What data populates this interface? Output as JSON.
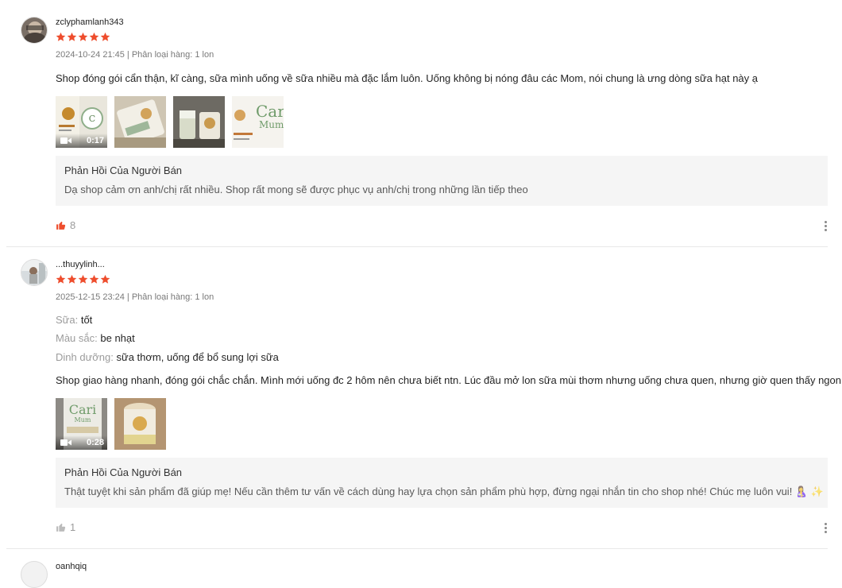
{
  "reviews": [
    {
      "username": "zclyphamlanh343",
      "rating": 5,
      "meta": "2024-10-24 21:45 | Phân loại hàng: 1 lon",
      "attributes": [],
      "content": "Shop đóng gói cẩn thận, kĩ càng, sữa mình uống về sữa nhiều mà đặc lắm luôn. Uống không bị nóng đâu các Mom, nói chung là ưng dòng sữa hạt này ạ",
      "media": [
        {
          "type": "video",
          "duration": "0:17"
        },
        {
          "type": "image"
        },
        {
          "type": "image"
        },
        {
          "type": "image"
        }
      ],
      "reply_title": "Phản Hồi Của Người Bán",
      "reply_text": "Dạ shop cảm ơn anh/chị rất nhiều. Shop rất mong sẽ được phục vụ anh/chị trong những lần tiếp theo",
      "likes": "8",
      "liked": true
    },
    {
      "username": "...thuyylinh...",
      "rating": 5,
      "meta": "2025-12-15 23:24 | Phân loại hàng: 1 lon",
      "attributes": [
        {
          "key": "Sữa:",
          "value": "tốt"
        },
        {
          "key": "Màu sắc:",
          "value": "be nhạt"
        },
        {
          "key": "Dinh dưỡng:",
          "value": "sữa thơm, uống để bổ sung lợi sữa"
        }
      ],
      "content": "Shop giao hàng nhanh, đóng gói chắc chắn. Mình mới uống đc 2 hôm nên chưa biết ntn. Lúc đầu mở lon sữa mùi thơm nhưng uống chưa quen, nhưng giờ quen thấy ngon.",
      "media": [
        {
          "type": "video",
          "duration": "0:28"
        },
        {
          "type": "image"
        }
      ],
      "reply_title": "Phản Hồi Của Người Bán",
      "reply_text": "Thật tuyệt khi sản phẩm đã giúp mẹ! Nếu cần thêm tư vấn về cách dùng hay lựa chọn sản phẩm phù hợp, đừng ngại nhắn tin cho shop nhé! Chúc mẹ luôn vui! 🤱 ✨",
      "likes": "1",
      "liked": false
    },
    {
      "username": "oanhqiq"
    }
  ],
  "colors": {
    "star": "#ee4d2d",
    "like_active": "#ee4d2d",
    "like_inactive": "#bbbbbb",
    "reply_bg": "#f5f5f5"
  }
}
